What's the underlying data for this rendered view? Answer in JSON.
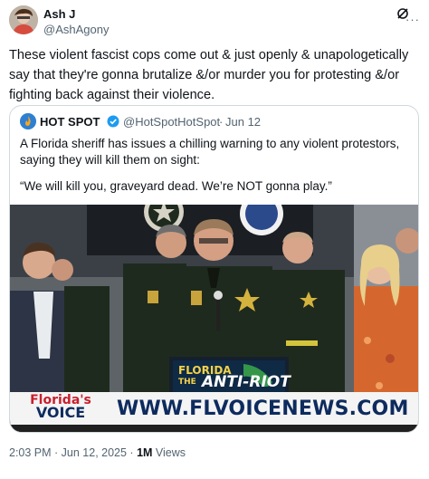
{
  "tweet": {
    "author_name": "Ash J",
    "author_handle": "@AshAgony",
    "text": "These violent fascist cops come out & just openly & unapologetically say that they're gonna brutalize &/or murder you for protesting &/or fighting back against their violence.",
    "timestamp": "2:03 PM · Jun 12, 2025 · ",
    "views_count": "1M",
    "views_label": " Views"
  },
  "quote": {
    "author_name": "HOT SPOT",
    "author_handle": "@HotSpotHotSpot",
    "separator": "·",
    "date": "Jun 12",
    "text_line1": "A Florida sheriff has issues a chilling warning to any violent protestors, saying they will kill them on sight:",
    "text_line2": "“We will kill you, graveyard dead. We’re NOT gonna play.”"
  },
  "image": {
    "podium_line1": "FLORIDA",
    "podium_line2": "THE",
    "podium_line3": "ANTI-RIOT",
    "banner_top": "Florida's",
    "banner_bottom": "VOICE",
    "banner_url": "WWW.FLVOICENEWS.COM"
  },
  "icons": {
    "more": "more-icon",
    "grok": "grok-icon",
    "verified": "verified-icon"
  },
  "colors": {
    "verified": "#1d9bf0",
    "secondary_text": "#536471",
    "border": "#cfd9de",
    "uniform": "#1f2a1e",
    "fv_red": "#c8202e",
    "fv_blue": "#0d2b5e"
  }
}
